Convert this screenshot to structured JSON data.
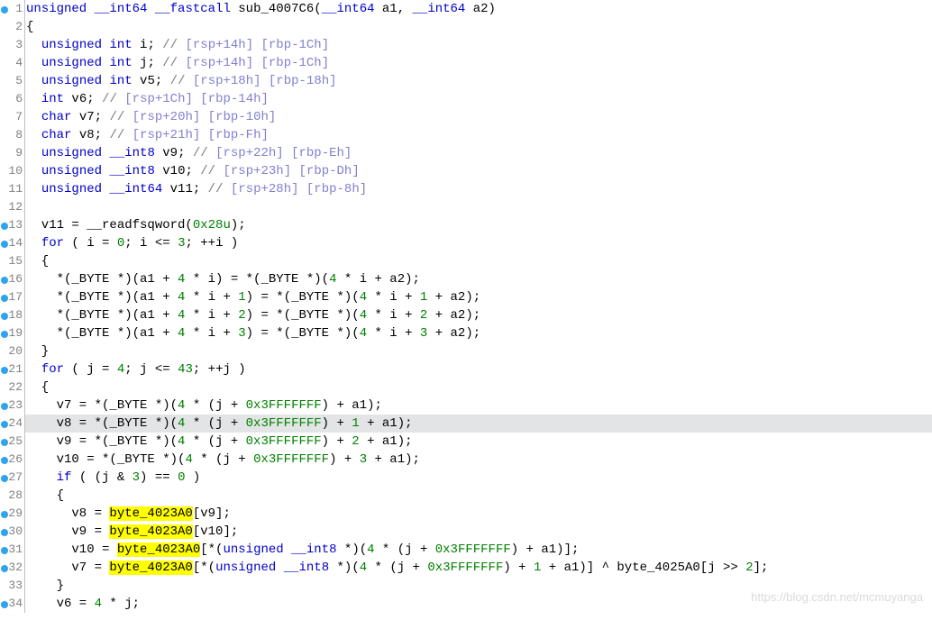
{
  "watermark": "https://blog.csdn.net/mcmuyanga",
  "lines": [
    {
      "n": 1,
      "bp": true,
      "html": "<span class='tp'>unsigned</span> <span class='tp'>__int64</span> <span class='tp'>__fastcall</span> sub_4007C6(<span class='tp'>__int64</span> a1, <span class='tp'>__int64</span> a2)"
    },
    {
      "n": 2,
      "bp": false,
      "html": "{"
    },
    {
      "n": 3,
      "bp": false,
      "html": "  <span class='tp'>unsigned</span> <span class='tp'>int</span> i; <span class='cm'>//</span> <span class='cmb'>[rsp+14h] [rbp-1Ch]</span>"
    },
    {
      "n": 4,
      "bp": false,
      "html": "  <span class='tp'>unsigned</span> <span class='tp'>int</span> j; <span class='cm'>//</span> <span class='cmb'>[rsp+14h] [rbp-1Ch]</span>"
    },
    {
      "n": 5,
      "bp": false,
      "html": "  <span class='tp'>unsigned</span> <span class='tp'>int</span> v5; <span class='cm'>//</span> <span class='cmb'>[rsp+18h] [rbp-18h]</span>"
    },
    {
      "n": 6,
      "bp": false,
      "html": "  <span class='tp'>int</span> v6; <span class='cm'>//</span> <span class='cmb'>[rsp+1Ch] [rbp-14h]</span>"
    },
    {
      "n": 7,
      "bp": false,
      "html": "  <span class='tp'>char</span> v7; <span class='cm'>//</span> <span class='cmb'>[rsp+20h] [rbp-10h]</span>"
    },
    {
      "n": 8,
      "bp": false,
      "html": "  <span class='tp'>char</span> v8; <span class='cm'>//</span> <span class='cmb'>[rsp+21h] [rbp-Fh]</span>"
    },
    {
      "n": 9,
      "bp": false,
      "html": "  <span class='tp'>unsigned</span> <span class='tp'>__int8</span> v9; <span class='cm'>//</span> <span class='cmb'>[rsp+22h] [rbp-Eh]</span>"
    },
    {
      "n": 10,
      "bp": false,
      "html": "  <span class='tp'>unsigned</span> <span class='tp'>__int8</span> v10; <span class='cm'>//</span> <span class='cmb'>[rsp+23h] [rbp-Dh]</span>"
    },
    {
      "n": 11,
      "bp": false,
      "html": "  <span class='tp'>unsigned</span> <span class='tp'>__int64</span> v11; <span class='cm'>//</span> <span class='cmb'>[rsp+28h] [rbp-8h]</span>"
    },
    {
      "n": 12,
      "bp": false,
      "html": ""
    },
    {
      "n": 13,
      "bp": true,
      "html": "  v11 = __readfsqword(<span class='nm'>0x28u</span>);"
    },
    {
      "n": 14,
      "bp": true,
      "html": "  <span class='kw'>for</span> ( i = <span class='nm'>0</span>; i &lt;= <span class='nm'>3</span>; ++i )"
    },
    {
      "n": 15,
      "bp": false,
      "html": "  {"
    },
    {
      "n": 16,
      "bp": true,
      "html": "    *(_BYTE *)(a1 + <span class='nm'>4</span> * i) = *(_BYTE *)(<span class='nm'>4</span> * i + a2);"
    },
    {
      "n": 17,
      "bp": true,
      "html": "    *(_BYTE *)(a1 + <span class='nm'>4</span> * i + <span class='nm'>1</span>) = *(_BYTE *)(<span class='nm'>4</span> * i + <span class='nm'>1</span> + a2);"
    },
    {
      "n": 18,
      "bp": true,
      "html": "    *(_BYTE *)(a1 + <span class='nm'>4</span> * i + <span class='nm'>2</span>) = *(_BYTE *)(<span class='nm'>4</span> * i + <span class='nm'>2</span> + a2);"
    },
    {
      "n": 19,
      "bp": true,
      "html": "    *(_BYTE *)(a1 + <span class='nm'>4</span> * i + <span class='nm'>3</span>) = *(_BYTE *)(<span class='nm'>4</span> * i + <span class='nm'>3</span> + a2);"
    },
    {
      "n": 20,
      "bp": false,
      "html": "  }"
    },
    {
      "n": 21,
      "bp": true,
      "html": "  <span class='kw'>for</span> ( j = <span class='nm'>4</span>; j &lt;= <span class='nm'>43</span>; ++j )"
    },
    {
      "n": 22,
      "bp": false,
      "html": "  {"
    },
    {
      "n": 23,
      "bp": true,
      "html": "    v7 = *(_BYTE *)(<span class='nm'>4</span> * (j + <span class='nm'>0x3FFFFFFF</span>) + a1);"
    },
    {
      "n": 24,
      "bp": true,
      "sel": true,
      "html": "    v8 = *(_BYTE *)(<span class='nm'>4</span> * (j + <span class='nm'>0x3FFFFFFF</span>) + <span class='nm'>1</span> + a1);"
    },
    {
      "n": 25,
      "bp": true,
      "html": "    v9 = *(_BYTE *)(<span class='nm'>4</span> * (j + <span class='nm'>0x3FFFFFFF</span>) + <span class='nm'>2</span> + a1);"
    },
    {
      "n": 26,
      "bp": true,
      "html": "    v10 = *(_BYTE *)(<span class='nm'>4</span> * (j + <span class='nm'>0x3FFFFFFF</span>) + <span class='nm'>3</span> + a1);"
    },
    {
      "n": 27,
      "bp": true,
      "html": "    <span class='kw'>if</span> ( (j &amp; <span class='nm'>3</span>) == <span class='nm'>0</span> )"
    },
    {
      "n": 28,
      "bp": false,
      "html": "    {"
    },
    {
      "n": 29,
      "bp": true,
      "html": "      v8 = <span class='hl'>byte_4023A0</span>[v9];"
    },
    {
      "n": 30,
      "bp": true,
      "html": "      v9 = <span class='hl'>byte_4023A0</span>[v10];"
    },
    {
      "n": 31,
      "bp": true,
      "html": "      v10 = <span class='hl'>byte_4023A0</span>[*(<span class='tp'>unsigned</span> <span class='tp'>__int8</span> *)(<span class='nm'>4</span> * (j + <span class='nm'>0x3FFFFFFF</span>) + a1)];"
    },
    {
      "n": 32,
      "bp": true,
      "html": "      v7 = <span class='hl'>byte_4023A0</span>[*(<span class='tp'>unsigned</span> <span class='tp'>__int8</span> *)(<span class='nm'>4</span> * (j + <span class='nm'>0x3FFFFFFF</span>) + <span class='nm'>1</span> + a1)] ^ byte_4025A0[j &gt;&gt; <span class='nm'>2</span>];"
    },
    {
      "n": 33,
      "bp": false,
      "html": "    }"
    },
    {
      "n": 34,
      "bp": true,
      "html": "    v6 = <span class='nm'>4</span> * j;"
    }
  ]
}
